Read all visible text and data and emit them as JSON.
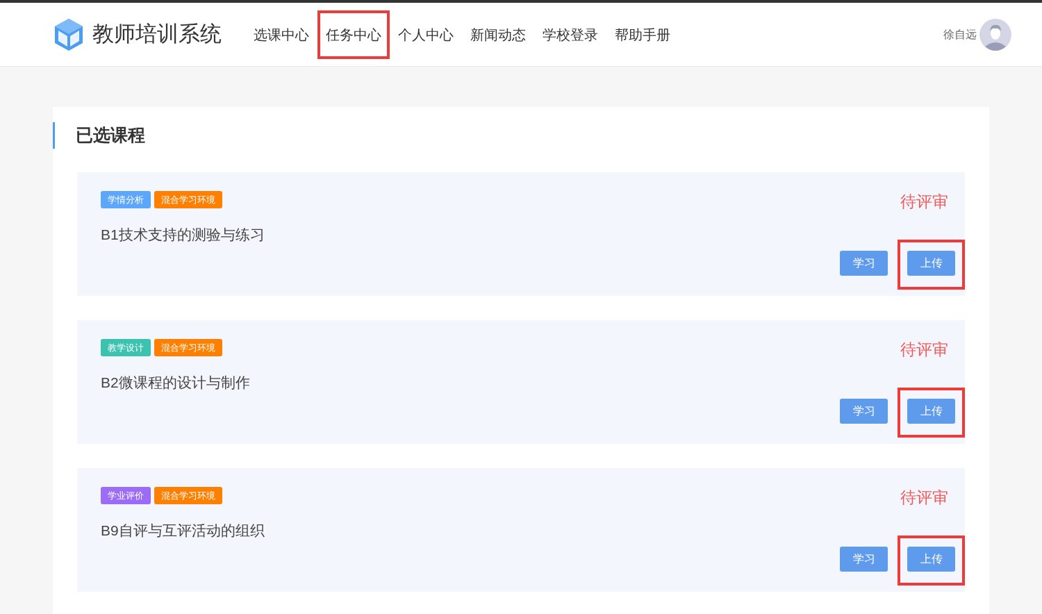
{
  "header": {
    "logo_text": "教师培训系统",
    "nav": [
      {
        "label": "选课中心",
        "highlighted": false
      },
      {
        "label": "任务中心",
        "highlighted": true
      },
      {
        "label": "个人中心",
        "highlighted": false
      },
      {
        "label": "新闻动态",
        "highlighted": false
      },
      {
        "label": "学校登录",
        "highlighted": false
      },
      {
        "label": "帮助手册",
        "highlighted": false
      }
    ],
    "user_name": "徐自远"
  },
  "section_title": "已选课程",
  "courses": [
    {
      "tags": [
        {
          "label": "学情分析",
          "color": "#5ca7fb"
        },
        {
          "label": "混合学习环境",
          "color": "#ff7f00"
        }
      ],
      "title": "B1技术支持的测验与练习",
      "status": "待评审",
      "buttons": [
        {
          "label": "学习",
          "highlighted": false
        },
        {
          "label": "上传",
          "highlighted": true
        }
      ]
    },
    {
      "tags": [
        {
          "label": "教学设计",
          "color": "#3cc3b0"
        },
        {
          "label": "混合学习环境",
          "color": "#ff7f00"
        }
      ],
      "title": "B2微课程的设计与制作",
      "status": "待评审",
      "buttons": [
        {
          "label": "学习",
          "highlighted": false
        },
        {
          "label": "上传",
          "highlighted": true
        }
      ]
    },
    {
      "tags": [
        {
          "label": "学业评价",
          "color": "#9b6cf6"
        },
        {
          "label": "混合学习环境",
          "color": "#ff7f00"
        }
      ],
      "title": "B9自评与互评活动的组织",
      "status": "待评审",
      "buttons": [
        {
          "label": "学习",
          "highlighted": false
        },
        {
          "label": "上传",
          "highlighted": true
        }
      ]
    }
  ]
}
